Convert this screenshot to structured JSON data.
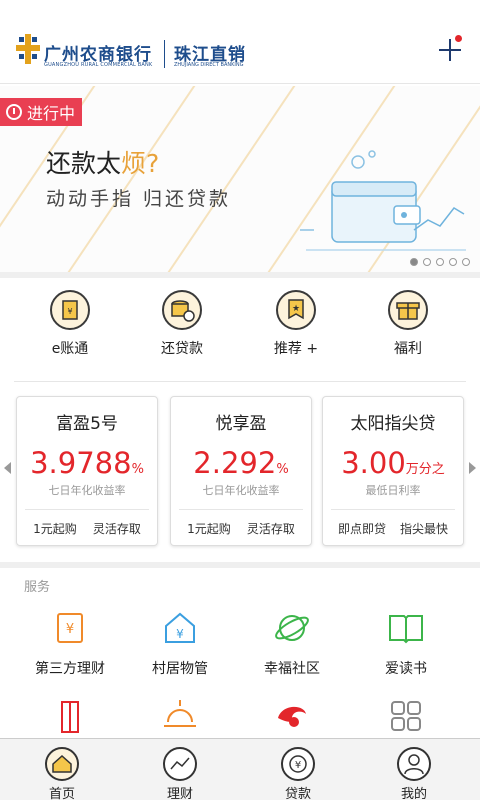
{
  "header": {
    "brand_cn": "广州农商银行",
    "brand_en": "GUANGZHOU RURAL COMMERCIAL BANK",
    "sub_cn": "珠江直销",
    "sub_en": "ZHUJIANG DIRECT BANKING",
    "logo_icon": "bank-logo-icon",
    "add_icon": "plus-icon",
    "accent": "#1e4d8c",
    "notify_color": "#e3262b"
  },
  "banner": {
    "badge": "进行中",
    "title_prefix": "还款太",
    "title_highlight": "烦?",
    "subtitle": "动动手指  归还贷款",
    "active_dot": 1,
    "dot_count": 5,
    "badge_color": "#e93f52"
  },
  "quick_menu": [
    {
      "label": "e账通",
      "icon": "e-account-icon"
    },
    {
      "label": "还贷款",
      "icon": "coins-icon"
    },
    {
      "label": "推荐 +",
      "icon": "star-badge-icon"
    },
    {
      "label": "福利",
      "icon": "gift-icon"
    }
  ],
  "products": [
    {
      "name": "富盈5号",
      "value": "3.9788",
      "unit": "%",
      "desc": "七日年化收益率",
      "tag1": "1元起购",
      "tag2": "灵活存取"
    },
    {
      "name": "悦享盈",
      "value": "2.292",
      "unit": "%",
      "desc": "七日年化收益率",
      "tag1": "1元起购",
      "tag2": "灵活存取"
    },
    {
      "name": "太阳指尖贷",
      "value": "3.00",
      "unit": "万分之",
      "desc": "最低日利率",
      "tag1": "即点即贷",
      "tag2": "指尖最快"
    }
  ],
  "services": {
    "title": "服务",
    "items": [
      {
        "label": "第三方理财",
        "icon": "finance-doc-icon"
      },
      {
        "label": "村居物管",
        "icon": "house-yuan-icon"
      },
      {
        "label": "幸福社区",
        "icon": "planet-icon"
      },
      {
        "label": "爱读书",
        "icon": "book-icon"
      },
      {
        "label": "",
        "icon": "building-icon"
      },
      {
        "label": "",
        "icon": "sunrise-icon"
      },
      {
        "label": "",
        "icon": "swirl-logo-icon"
      },
      {
        "label": "",
        "icon": "grid-more-icon"
      }
    ]
  },
  "nav": [
    {
      "label": "首页",
      "icon": "home-icon"
    },
    {
      "label": "理财",
      "icon": "chart-trend-icon"
    },
    {
      "label": "贷款",
      "icon": "loan-yuan-icon"
    },
    {
      "label": "我的",
      "icon": "user-icon"
    }
  ]
}
